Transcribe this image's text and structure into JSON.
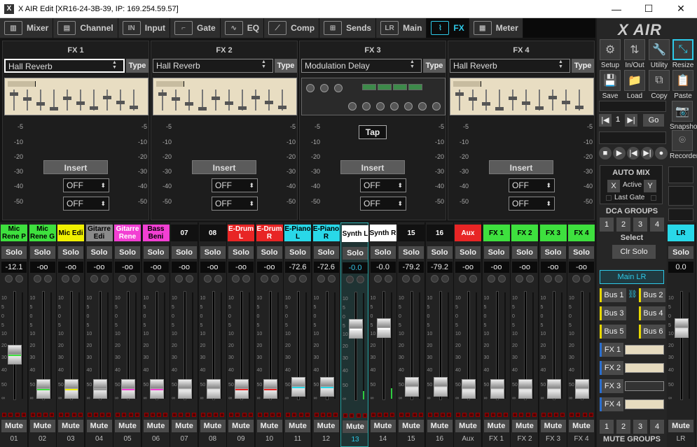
{
  "window": {
    "title": "X AIR Edit [XR16-24-3B-39, IP: 169.254.59.57]",
    "app_icon": "X",
    "min": "—",
    "max": "☐",
    "close": "✕"
  },
  "tabs": [
    {
      "label": "Mixer",
      "icon": "mixer-icon",
      "glyph": "▥"
    },
    {
      "label": "Channel",
      "icon": "channel-icon",
      "glyph": "▤"
    },
    {
      "label": "Input",
      "icon": "input-icon",
      "glyph": "IN"
    },
    {
      "label": "Gate",
      "icon": "gate-icon",
      "glyph": "⌐"
    },
    {
      "label": "EQ",
      "icon": "eq-icon",
      "glyph": "∿"
    },
    {
      "label": "Comp",
      "icon": "comp-icon",
      "glyph": "⟋"
    },
    {
      "label": "Sends",
      "icon": "sends-icon",
      "glyph": "⊞"
    },
    {
      "label": "Main",
      "icon": "main-icon",
      "glyph": "LR"
    },
    {
      "label": "FX",
      "icon": "fx-icon",
      "glyph": "⌇"
    },
    {
      "label": "Meter",
      "icon": "meter-icon",
      "glyph": "▦"
    }
  ],
  "active_tab": "FX",
  "fx": [
    {
      "title": "FX 1",
      "effect": "Hall Reverb",
      "type_label": "Type",
      "insert_label": "Insert",
      "send1": "OFF",
      "send2": "OFF",
      "dark": false,
      "has_tap": false
    },
    {
      "title": "FX 2",
      "effect": "Hall Reverb",
      "type_label": "Type",
      "insert_label": "Insert",
      "send1": "OFF",
      "send2": "OFF",
      "dark": false,
      "has_tap": false
    },
    {
      "title": "FX 3",
      "effect": "Modulation Delay",
      "type_label": "Type",
      "insert_label": "Insert",
      "send1": "OFF",
      "send2": "OFF",
      "dark": true,
      "has_tap": true,
      "tap_label": "Tap"
    },
    {
      "title": "FX 4",
      "effect": "Hall Reverb",
      "type_label": "Type",
      "insert_label": "Insert",
      "send1": "OFF",
      "send2": "OFF",
      "dark": false,
      "has_tap": false
    }
  ],
  "fx_scale": [
    "-5",
    "-10",
    "-20",
    "-30",
    "-40",
    "-50"
  ],
  "fader_scale": [
    "10",
    "5",
    "0",
    "5",
    "10",
    "20",
    "30",
    "40",
    "50",
    "∞"
  ],
  "channels": [
    {
      "name": "Mic Rene P",
      "color": "#3ee03e",
      "text_color": "#000",
      "solo": "Solo",
      "gain": "-12.1",
      "fader": 0.45,
      "stripe": "#3ee03e",
      "meter": 0,
      "mute": "Mute",
      "num": "01"
    },
    {
      "name": "Mic Rene G",
      "color": "#3ee03e",
      "text_color": "#000",
      "solo": "Solo",
      "gain": "-oo",
      "fader": 0.1,
      "stripe": "#3ee03e",
      "meter": 0,
      "mute": "Mute",
      "num": "02"
    },
    {
      "name": "Mic Edi",
      "color": "#f0f000",
      "text_color": "#000",
      "solo": "Solo",
      "gain": "-oo",
      "fader": 0.1,
      "stripe": "#f0f000",
      "meter": 0,
      "mute": "Mute",
      "num": "03"
    },
    {
      "name": "Gitarre Edi",
      "color": "#8a8a8a",
      "text_color": "#000",
      "solo": "Solo",
      "gain": "-oo",
      "fader": 0.1,
      "stripe": "#999999",
      "meter": 0,
      "mute": "Mute",
      "num": "04"
    },
    {
      "name": "Gitarre Rene",
      "color": "#f23fd3",
      "text_color": "#fff",
      "solo": "Solo",
      "gain": "-oo",
      "fader": 0.1,
      "stripe": "#f23fd3",
      "meter": 0,
      "mute": "Mute",
      "num": "05"
    },
    {
      "name": "Bass Beni",
      "color": "#f23fd3",
      "text_color": "#000",
      "solo": "Solo",
      "gain": "-oo",
      "fader": 0.1,
      "stripe": "#f23fd3",
      "meter": 0,
      "mute": "Mute",
      "num": "06"
    },
    {
      "name": "07",
      "color": "#111111",
      "text_color": "#fff",
      "solo": "Solo",
      "gain": "-oo",
      "fader": 0.1,
      "stripe": "#dddddd",
      "meter": 0,
      "mute": "Mute",
      "num": "07"
    },
    {
      "name": "08",
      "color": "#111111",
      "text_color": "#fff",
      "solo": "Solo",
      "gain": "-oo",
      "fader": 0.1,
      "stripe": "#dddddd",
      "meter": 0,
      "mute": "Mute",
      "num": "08"
    },
    {
      "name": "E-Drum L",
      "color": "#e82525",
      "text_color": "#fff",
      "solo": "Solo",
      "gain": "-oo",
      "fader": 0.1,
      "stripe": "#e82525",
      "meter": 0,
      "mute": "Mute",
      "num": "09"
    },
    {
      "name": "E-Drum R",
      "color": "#e82525",
      "text_color": "#fff",
      "solo": "Solo",
      "gain": "-oo",
      "fader": 0.1,
      "stripe": "#e82525",
      "meter": 0,
      "mute": "Mute",
      "num": "10"
    },
    {
      "name": "E-Piano L",
      "color": "#29d8e8",
      "text_color": "#000",
      "solo": "Solo",
      "gain": "-72.6",
      "fader": 0.12,
      "stripe": "#29d8e8",
      "meter": 0,
      "mute": "Mute",
      "num": "11"
    },
    {
      "name": "E-Piano R",
      "color": "#29d8e8",
      "text_color": "#000",
      "solo": "Solo",
      "gain": "-72.6",
      "fader": 0.12,
      "stripe": "#29d8e8",
      "meter": 0,
      "mute": "Mute",
      "num": "12"
    },
    {
      "name": "Synth L",
      "color": "#ffffff",
      "text_color": "#000",
      "solo": "Solo",
      "gain": "-0.0",
      "fader": 0.72,
      "stripe": "#ffffff",
      "meter": 0.08,
      "mute": "Mute",
      "num": "13",
      "selected": true
    },
    {
      "name": "Synth R",
      "color": "#ffffff",
      "text_color": "#000",
      "solo": "Solo",
      "gain": "-0.0",
      "fader": 0.72,
      "stripe": "#ffffff",
      "meter": 0.1,
      "mute": "Mute",
      "num": "14"
    },
    {
      "name": "15",
      "color": "#111111",
      "text_color": "#fff",
      "solo": "Solo",
      "gain": "-79.2",
      "fader": 0.12,
      "stripe": "#dddddd",
      "meter": 0,
      "mute": "Mute",
      "num": "15"
    },
    {
      "name": "16",
      "color": "#111111",
      "text_color": "#fff",
      "solo": "Solo",
      "gain": "-79.2",
      "fader": 0.12,
      "stripe": "#dddddd",
      "meter": 0,
      "mute": "Mute",
      "num": "16"
    },
    {
      "name": "Aux",
      "color": "#e82525",
      "text_color": "#fff",
      "solo": "Solo",
      "gain": "-oo",
      "fader": 0.1,
      "stripe": "#dddddd",
      "meter": 0,
      "mute": "Mute",
      "num": "Aux"
    },
    {
      "name": "FX 1",
      "color": "#3ee03e",
      "text_color": "#000",
      "solo": "Solo",
      "gain": "-oo",
      "fader": 0.1,
      "stripe": "#dddddd",
      "meter": 0,
      "mute": "Mute",
      "num": "FX 1"
    },
    {
      "name": "FX 2",
      "color": "#3ee03e",
      "text_color": "#000",
      "solo": "Solo",
      "gain": "-oo",
      "fader": 0.1,
      "stripe": "#dddddd",
      "meter": 0,
      "mute": "Mute",
      "num": "FX 2"
    },
    {
      "name": "FX 3",
      "color": "#3ee03e",
      "text_color": "#000",
      "solo": "Solo",
      "gain": "-oo",
      "fader": 0.1,
      "stripe": "#dddddd",
      "meter": 0,
      "mute": "Mute",
      "num": "FX 3"
    },
    {
      "name": "FX 4",
      "color": "#3ee03e",
      "text_color": "#000",
      "solo": "Solo",
      "gain": "-oo",
      "fader": 0.1,
      "stripe": "#dddddd",
      "meter": 0,
      "mute": "Mute",
      "num": "FX 4"
    }
  ],
  "right": {
    "logo": "X AIR",
    "tools": [
      {
        "label": "Setup",
        "icon": "gear-icon",
        "glyph": "⚙"
      },
      {
        "label": "In/Out",
        "icon": "in-out-icon",
        "glyph": "⇅"
      },
      {
        "label": "Utility",
        "icon": "wrench-icon",
        "glyph": "🔧"
      },
      {
        "label": "Resize",
        "icon": "resize-icon",
        "glyph": "⤡",
        "active": true
      },
      {
        "label": "Save",
        "icon": "save-icon",
        "glyph": "💾"
      },
      {
        "label": "Load",
        "icon": "folder-icon",
        "glyph": "📁"
      },
      {
        "label": "Copy",
        "icon": "copy-icon",
        "glyph": "⧉"
      },
      {
        "label": "Paste",
        "icon": "paste-icon",
        "glyph": "📋"
      }
    ],
    "snapshot": {
      "prev": "|◀",
      "num": "1",
      "next": "▶|",
      "go": "Go",
      "label": "Snapshot"
    },
    "recorder": {
      "label": "Recorder",
      "controls": [
        "■",
        "▶",
        "|◀",
        "▶|",
        "●"
      ]
    },
    "automix": {
      "title": "AUTO MIX",
      "x": "X",
      "active": "Active",
      "y": "Y",
      "lastgate": "Last Gate"
    },
    "dca": {
      "title": "DCA GROUPS",
      "buttons": [
        "1",
        "2",
        "3",
        "4"
      ]
    },
    "select": {
      "title": "Select",
      "clr_solo": "Clr Solo"
    },
    "main_lr": "Main LR",
    "buses": [
      "Bus 1",
      "Bus 2",
      "Bus 3",
      "Bus 4",
      "Bus 5",
      "Bus 6"
    ],
    "fx_buses": [
      "FX 1",
      "FX 2",
      "FX 3",
      "FX 4"
    ],
    "mute_groups": {
      "title": "MUTE GROUPS",
      "buttons": [
        "1",
        "2",
        "3",
        "4"
      ]
    },
    "lr": {
      "name": "LR",
      "solo": "Solo",
      "gain": "0.0",
      "mute": "Mute",
      "num": "LR",
      "fader": 0.72
    }
  }
}
